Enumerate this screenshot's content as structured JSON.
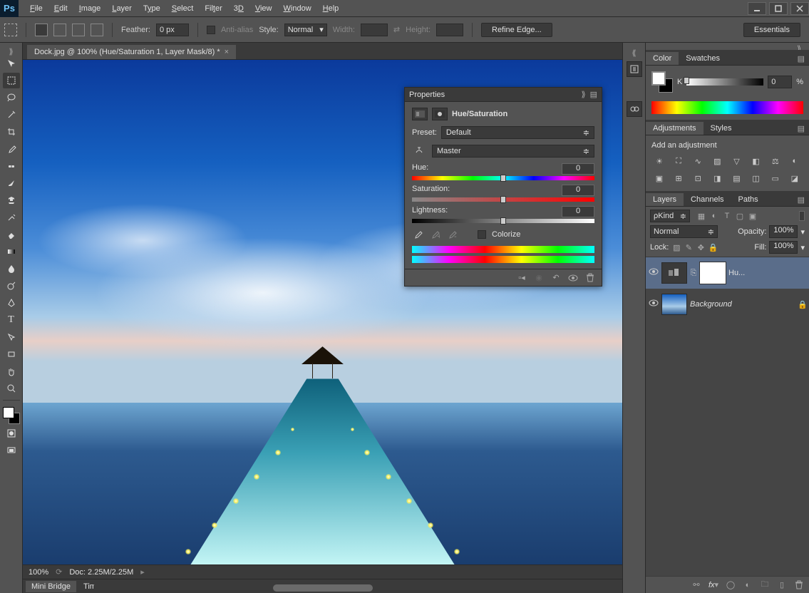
{
  "app": {
    "name": "Ps"
  },
  "menu": [
    "File",
    "Edit",
    "Image",
    "Layer",
    "Type",
    "Select",
    "Filter",
    "3D",
    "View",
    "Window",
    "Help"
  ],
  "options_bar": {
    "feather_label": "Feather:",
    "feather_value": "0 px",
    "antialias_label": "Anti-alias",
    "style_label": "Style:",
    "style_value": "Normal",
    "width_label": "Width:",
    "height_label": "Height:",
    "refine_edge": "Refine Edge...",
    "essentials": "Essentials"
  },
  "document": {
    "tab_title": "Dock.jpg @ 100% (Hue/Saturation 1, Layer Mask/8) *",
    "zoom": "100%",
    "doc_size": "Doc: 2.25M/2.25M"
  },
  "properties": {
    "panel_title": "Properties",
    "adjustment_name": "Hue/Saturation",
    "preset_label": "Preset:",
    "preset_value": "Default",
    "channel_value": "Master",
    "hue_label": "Hue:",
    "hue_value": "0",
    "saturation_label": "Saturation:",
    "saturation_value": "0",
    "lightness_label": "Lightness:",
    "lightness_value": "0",
    "colorize_label": "Colorize"
  },
  "color_panel": {
    "tabs": [
      "Color",
      "Swatches"
    ],
    "mode": "K",
    "value": "0",
    "unit": "%"
  },
  "adjustments_panel": {
    "tabs": [
      "Adjustments",
      "Styles"
    ],
    "heading": "Add an adjustment"
  },
  "layers_panel": {
    "tabs": [
      "Layers",
      "Channels",
      "Paths"
    ],
    "kind_label": "Kind",
    "blend_mode": "Normal",
    "opacity_label": "Opacity:",
    "opacity_value": "100%",
    "lock_label": "Lock:",
    "fill_label": "Fill:",
    "fill_value": "100%",
    "layers": [
      {
        "name": "Hu...",
        "type": "adjustment",
        "selected": true,
        "locked": false
      },
      {
        "name": "Background",
        "type": "background",
        "selected": false,
        "locked": true
      }
    ]
  },
  "bottom_tabs": [
    "Mini Bridge",
    "Timeline"
  ]
}
